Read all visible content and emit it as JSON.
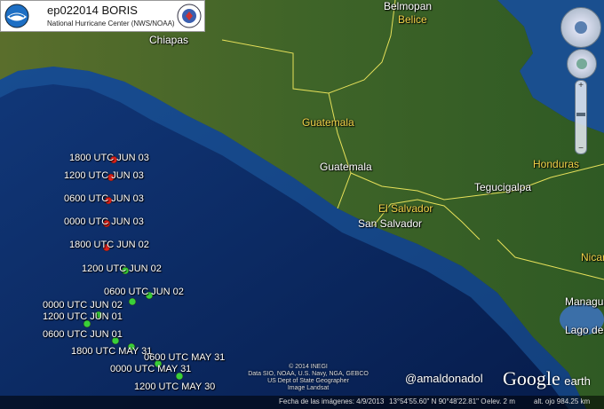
{
  "infobox": {
    "title": "ep022014 BORIS",
    "subtitle": "National Hurricane Center (NWS/NOAA)"
  },
  "places": {
    "belmopan": "Belmopan",
    "belize": "Belice",
    "chiapas": "Chiapas",
    "guatemala_country": "Guatemala",
    "guatemala_city": "Guatemala",
    "honduras": "Honduras",
    "tegucigalpa": "Tegucigalpa",
    "el_salvador": "El Salvador",
    "san_salvador": "San Salvador",
    "nicaragua": "Nicar",
    "managua": "Managua",
    "lago": "Lago de"
  },
  "track_points": [
    {
      "label": "1800 UTC JUN 03",
      "color": "#e0201a"
    },
    {
      "label": "1200 UTC JUN 03",
      "color": "#e0201a"
    },
    {
      "label": "0600 UTC JUN 03",
      "color": "#e0201a"
    },
    {
      "label": "0000 UTC JUN 03",
      "color": "#e0201a"
    },
    {
      "label": "1800 UTC JUN 02",
      "color": "#e0201a"
    },
    {
      "label": "1200 UTC JUN 02",
      "color": "#39d139"
    },
    {
      "label": "0600 UTC JUN 02",
      "color": "#39d139"
    },
    {
      "label": "0000 UTC JUN 02",
      "color": "#39d139"
    },
    {
      "label": "1200 UTC JUN 01",
      "color": "#39d139"
    },
    {
      "label": "0600 UTC JUN 01",
      "color": "#39d139"
    },
    {
      "label": "1800 UTC MAY 31",
      "color": "#39d139"
    },
    {
      "label": "0600 UTC MAY 31",
      "color": "#39d139"
    },
    {
      "label": "0000 UTC MAY 31",
      "color": "#39d139"
    },
    {
      "label": "1200 UTC MAY 30",
      "color": "#39d139"
    }
  ],
  "credits": {
    "line1": "© 2014 INEGI",
    "line2": "Data SIO, NOAA, U.S. Navy, NGA, GEBCO",
    "line3": "US Dept of State Geographer",
    "line4": "Image Landsat"
  },
  "watermark": "@amaldonadol",
  "brand": {
    "google": "Google",
    "earth": "earth"
  },
  "footer": {
    "date": "Fecha de las imágenes: 4/9/2013",
    "coords": "13°54'55.60\" N   90°48'22.81\" O",
    "elev": "elev.   2 m",
    "alt": "alt. ojo 984.25 km"
  },
  "colors": {
    "ocean": "#0b2a66",
    "land": "#4a6a2a",
    "border": "#e6e05a",
    "hurricane_red": "#e0201a",
    "tropical_green": "#39d139"
  }
}
